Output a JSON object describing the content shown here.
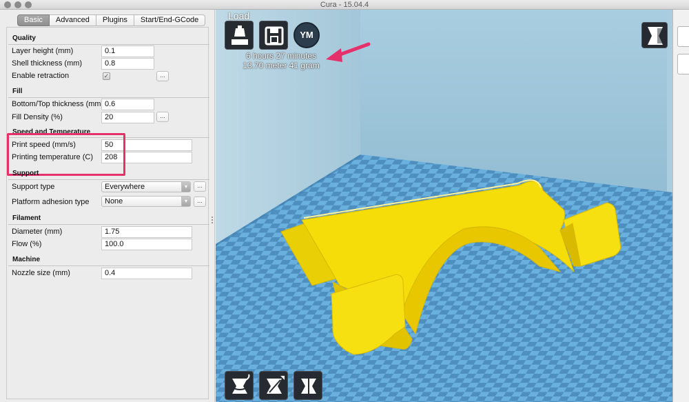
{
  "window": {
    "title": "Cura - 15.04.4"
  },
  "tabs": [
    {
      "label": "Basic",
      "active": true
    },
    {
      "label": "Advanced",
      "active": false
    },
    {
      "label": "Plugins",
      "active": false
    },
    {
      "label": "Start/End-GCode",
      "active": false
    }
  ],
  "quality": {
    "title": "Quality",
    "layer_height_label": "Layer height (mm)",
    "layer_height_value": "0.1",
    "shell_thickness_label": "Shell thickness (mm)",
    "shell_thickness_value": "0.8",
    "retraction_label": "Enable retraction",
    "retraction_checked": true
  },
  "fill": {
    "title": "Fill",
    "bottom_top_label": "Bottom/Top thickness (mm)",
    "bottom_top_value": "0.6",
    "density_label": "Fill Density (%)",
    "density_value": "20"
  },
  "speed": {
    "title": "Speed and Temperature",
    "print_speed_label": "Print speed (mm/s)",
    "print_speed_value": "50",
    "temp_label": "Printing temperature (C)",
    "temp_value": "208"
  },
  "support": {
    "title": "Support",
    "type_label": "Support type",
    "type_value": "Everywhere",
    "adhesion_label": "Platform adhesion type",
    "adhesion_value": "None"
  },
  "filament": {
    "title": "Filament",
    "diameter_label": "Diameter (mm)",
    "diameter_value": "1.75",
    "flow_label": "Flow (%)",
    "flow_value": "100.0"
  },
  "machine": {
    "title": "Machine",
    "nozzle_label": "Nozzle size (mm)",
    "nozzle_value": "0.4"
  },
  "buttons": {
    "more_label": "...",
    "check_glyph": "✓",
    "dropdown_glyph": "▾"
  },
  "viewer": {
    "load_label": "Load",
    "ym_label": "YM",
    "print_time": "6 hours 27 minutes",
    "material": "13.70 meter 41 gram",
    "highlight_color": "#e6306c",
    "model_color": "#f5dd0a",
    "bed_colors": [
      "#6ab0dd",
      "#4f8fc0"
    ]
  }
}
